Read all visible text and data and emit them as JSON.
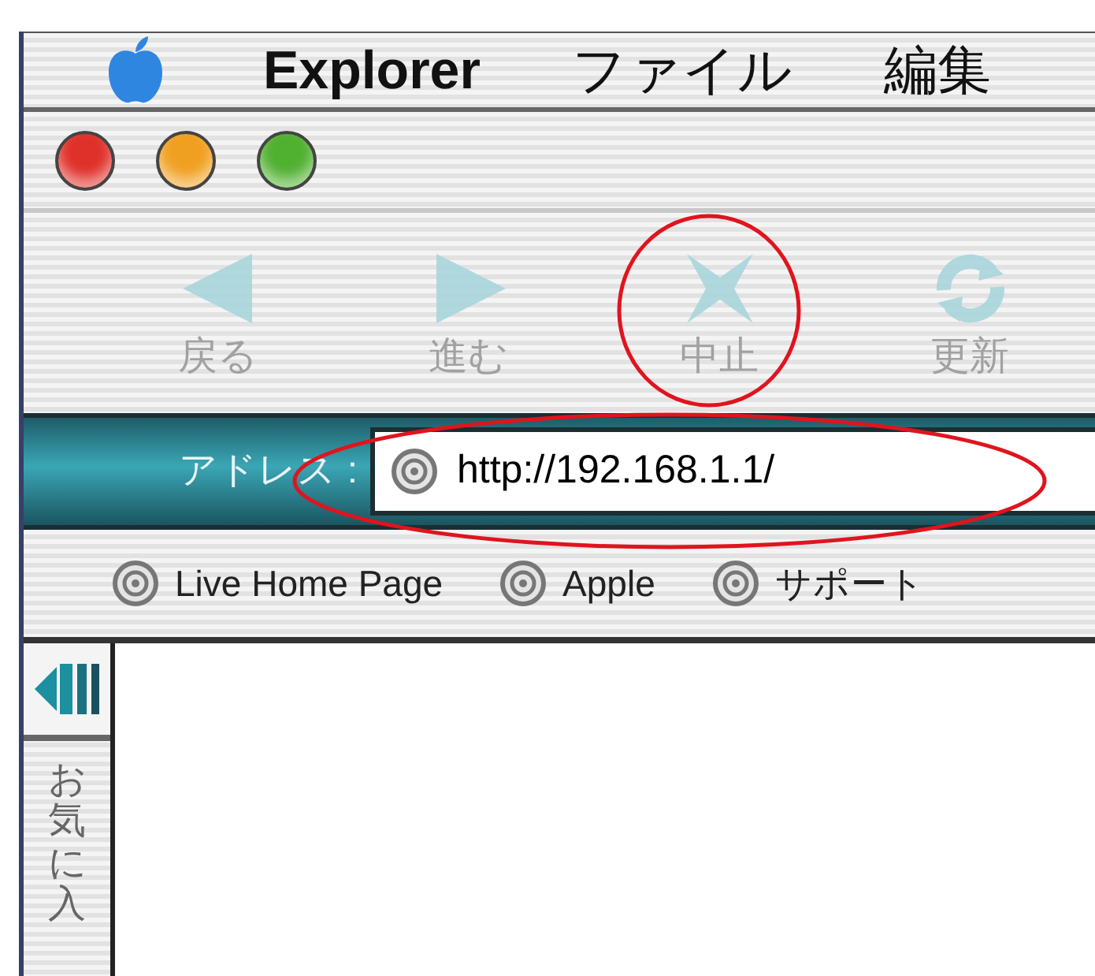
{
  "menu_bar": {
    "items": [
      {
        "kind": "apple"
      },
      {
        "kind": "app",
        "label": "Explorer"
      },
      {
        "kind": "menu",
        "label": "ファイル"
      },
      {
        "kind": "menu",
        "label": "編集"
      }
    ]
  },
  "window": {
    "buttons": [
      {
        "color": "#e0302a"
      },
      {
        "color": "#f0a020"
      },
      {
        "color": "#50b030"
      }
    ]
  },
  "toolbar": {
    "buttons": [
      {
        "kind": "back",
        "label": "戻る",
        "disabled": true
      },
      {
        "kind": "forward",
        "label": "進む",
        "disabled": true
      },
      {
        "kind": "stop",
        "label": "中止",
        "disabled": true
      },
      {
        "kind": "refresh",
        "label": "更新",
        "disabled": true
      }
    ]
  },
  "address_bar": {
    "label": "アドレス :",
    "value": "http://192.168.1.1/"
  },
  "favorites_bar": {
    "items": [
      {
        "label": "Live Home Page"
      },
      {
        "label": "Apple"
      },
      {
        "label": "サポート"
      }
    ]
  },
  "side_tab": {
    "label": "お気に入"
  }
}
